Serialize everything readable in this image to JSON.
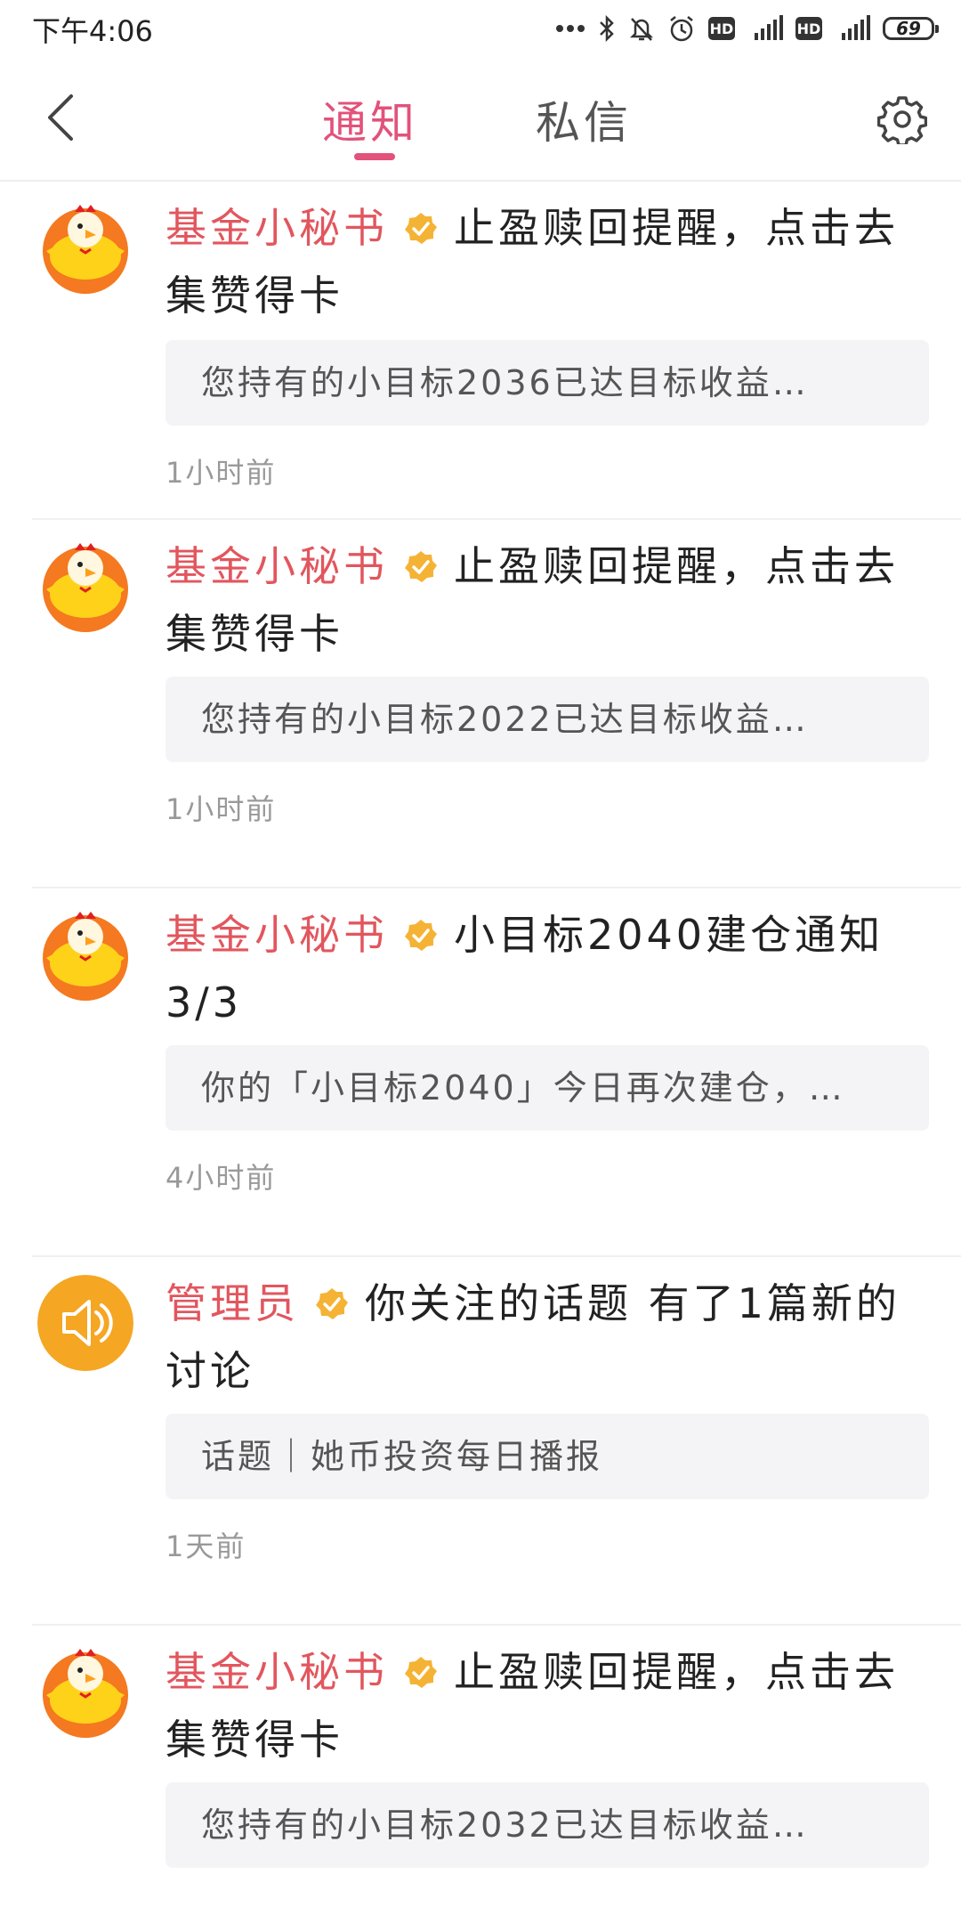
{
  "status_bar": {
    "time": "下午4:06",
    "battery": "69",
    "network": "4G",
    "hd_label": "HD"
  },
  "header": {
    "tabs": [
      {
        "label": "通知",
        "active": true
      },
      {
        "label": "私信",
        "active": false
      }
    ],
    "active_color": "#e2527a"
  },
  "notifications": [
    {
      "sender": "基金小秘书",
      "title": "止盈赎回提醒，点击去集赞得卡",
      "preview": "您持有的小目标2036已达目标收益…",
      "time": "1小时前",
      "avatar": "chicken-avatar"
    },
    {
      "sender": "基金小秘书",
      "title": "止盈赎回提醒，点击去集赞得卡",
      "preview": "您持有的小目标2022已达目标收益…",
      "time": "1小时前",
      "avatar": "chicken-avatar"
    },
    {
      "sender": "基金小秘书",
      "title": "小目标2040建仓通知3/3",
      "preview": "你的「小目标2040」今日再次建仓，…",
      "time": "4小时前",
      "avatar": "chicken-avatar"
    },
    {
      "sender": "管理员",
      "title": "你关注的话题 有了1篇新的讨论",
      "preview": "话题｜她币投资每日播报",
      "time": "1天前",
      "avatar": "speaker-avatar"
    },
    {
      "sender": "基金小秘书",
      "title": "止盈赎回提醒，点击去集赞得卡",
      "preview": "您持有的小目标2032已达目标收益…",
      "time": "",
      "avatar": "chicken-avatar"
    }
  ],
  "colors": {
    "sender": "#e2565e",
    "verified": "#f5b335",
    "preview_bg": "#f4f4f6",
    "avatar_orange": "#f5a623"
  }
}
